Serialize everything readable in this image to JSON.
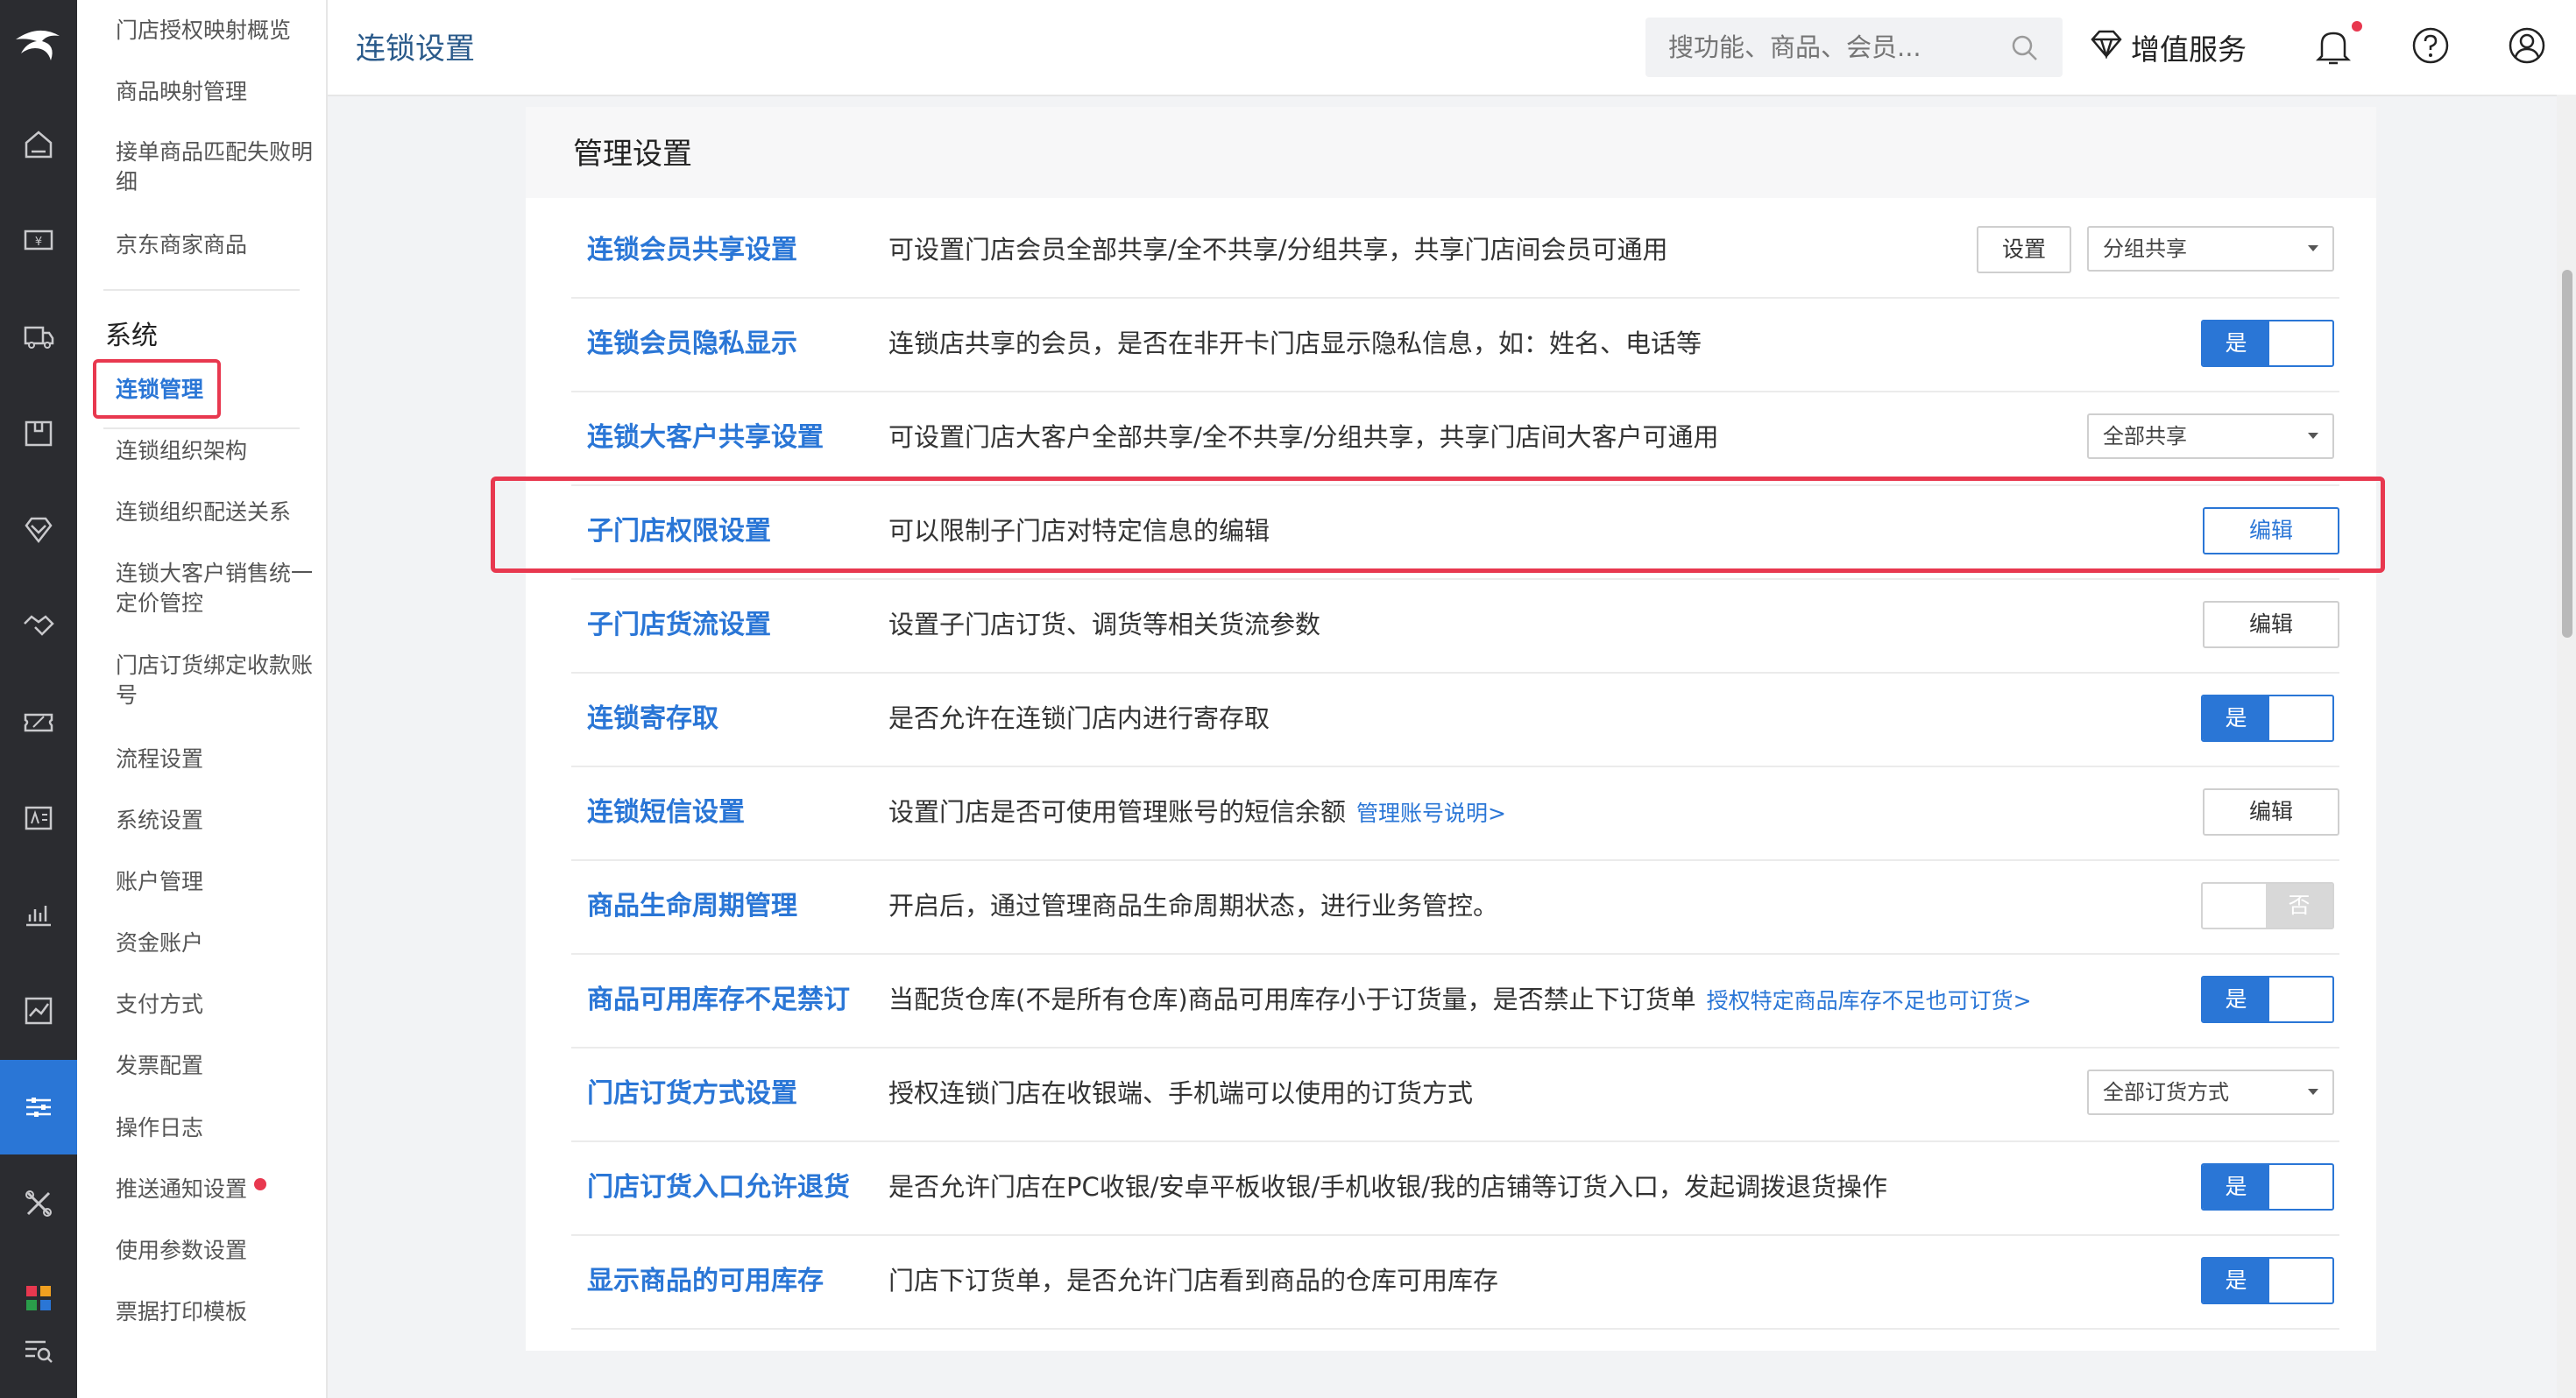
{
  "header": {
    "title": "连锁设置",
    "search_placeholder": "搜功能、商品、会员...",
    "value_added_label": "增值服务"
  },
  "submenu": {
    "top_items": [
      "门店授权映射概览",
      "商品映射管理",
      "接单商品匹配失败明细",
      "京东商家商品"
    ],
    "section_title": "系统",
    "active_item": "连锁管理",
    "items": [
      "连锁组织架构",
      "连锁组织配送关系",
      "连锁大客户销售统一定价管控",
      "门店订货绑定收款账号",
      "流程设置",
      "系统设置",
      "账户管理",
      "资金账户",
      "支付方式",
      "发票配置",
      "操作日志",
      "推送通知设置",
      "使用参数设置",
      "票据打印模板"
    ]
  },
  "card": {
    "title": "管理设置",
    "rows": [
      {
        "name": "连锁会员共享设置",
        "desc": "可设置门店会员全部共享/全不共享/分组共享，共享门店间会员可通用",
        "button": "设置",
        "select": "分组共享"
      },
      {
        "name": "连锁会员隐私显示",
        "desc": "连锁店共享的会员，是否在非开卡门店显示隐私信息，如：姓名、电话等",
        "toggle": "是"
      },
      {
        "name": "连锁大客户共享设置",
        "desc": "可设置门店大客户全部共享/全不共享/分组共享，共享门店间大客户可通用",
        "select": "全部共享"
      },
      {
        "name": "子门店权限设置",
        "desc": "可以限制子门店对特定信息的编辑",
        "button": "编辑"
      },
      {
        "name": "子门店货流设置",
        "desc": "设置子门店订货、调货等相关货流参数",
        "button": "编辑"
      },
      {
        "name": "连锁寄存取",
        "desc": "是否允许在连锁门店内进行寄存取",
        "toggle": "是"
      },
      {
        "name": "连锁短信设置",
        "desc": "设置门店是否可使用管理账号的短信余额",
        "link": "管理账号说明>",
        "button": "编辑"
      },
      {
        "name": "商品生命周期管理",
        "desc": "开启后，通过管理商品生命周期状态，进行业务管控。",
        "toggle_off": "否"
      },
      {
        "name": "商品可用库存不足禁订",
        "desc": "当配货仓库(不是所有仓库)商品可用库存小于订货量，是否禁止下订货单",
        "link": "授权特定商品库存不足也可订货>",
        "toggle": "是"
      },
      {
        "name": "门店订货方式设置",
        "desc": "授权连锁门店在收银端、手机端可以使用的订货方式",
        "select": "全部订货方式"
      },
      {
        "name": "门店订货入口允许退货",
        "desc": "是否允许门店在PC收银/安卓平板收银/手机收银/我的店铺等订货入口，发起调拨退货操作",
        "toggle": "是"
      },
      {
        "name": "显示商品的可用库存",
        "desc": "门店下订货单，是否允许门店看到商品的仓库可用库存",
        "toggle": "是"
      }
    ]
  },
  "colors": {
    "accent": "#2a76d6",
    "highlight": "#e8384f",
    "rail": "#2b2c30"
  },
  "icons": [
    "logo-icon",
    "home-icon",
    "cash-icon",
    "delivery-icon",
    "inventory-icon",
    "member-icon",
    "handshake-icon",
    "coupon-icon",
    "report-card-icon",
    "analytics-icon",
    "chart-icon",
    "settings-sliders-icon",
    "tools-icon",
    "apps-icon",
    "search-list-icon",
    "search-icon",
    "diamond-icon",
    "bell-icon",
    "help-icon",
    "user-icon"
  ]
}
